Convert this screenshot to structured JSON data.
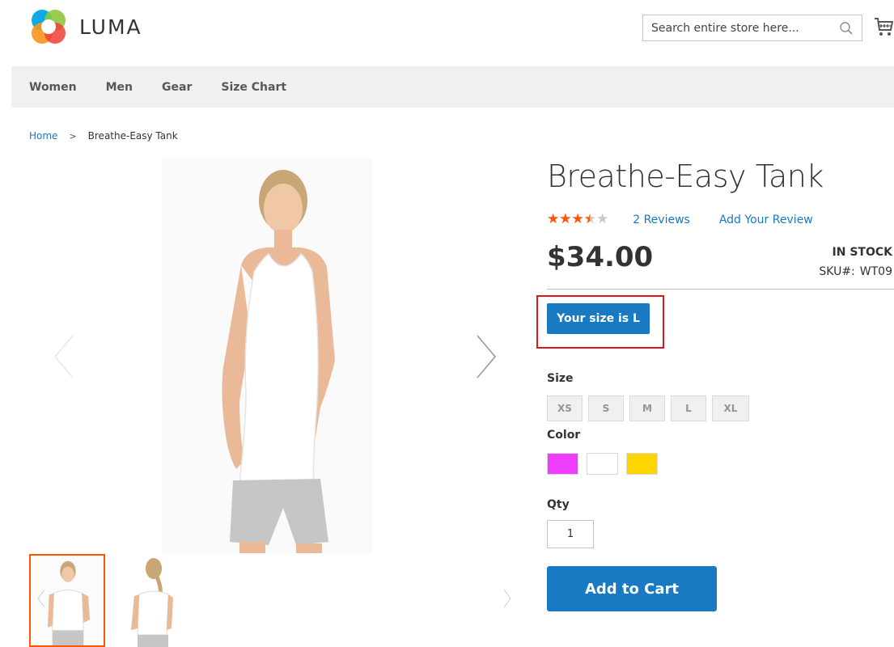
{
  "header": {
    "logo_text": "LUMA",
    "search_placeholder": "Search entire store here...",
    "icons": [
      "luma-logo-icon",
      "search-icon",
      "cart-icon"
    ]
  },
  "nav": {
    "items": [
      "Women",
      "Men",
      "Gear",
      "Size Chart"
    ]
  },
  "breadcrumb": {
    "home": "Home",
    "separator": ">",
    "current": "Breathe-Easy Tank"
  },
  "product": {
    "name": "Breathe-Easy Tank",
    "rating_percent": 70,
    "stars": "★★★★★",
    "reviews_count": "2",
    "reviews_label": "Reviews",
    "add_review": "Add Your Review",
    "price": "$34.00",
    "stock": "IN STOCK",
    "sku_label": "SKU#:",
    "sku": "WT09",
    "size_recommendation": "Your size is L",
    "size_label": "Size",
    "sizes": [
      "XS",
      "S",
      "M",
      "L",
      "XL"
    ],
    "color_label": "Color",
    "colors": [
      "#ef3dff",
      "#ffffff",
      "#ffd500"
    ],
    "qty_label": "Qty",
    "qty_value": "1",
    "add_to_cart": "Add to Cart"
  },
  "colors": {
    "accent": "#1979c3",
    "rating": "#ff5501",
    "highlight_box": "#e0141a",
    "nav_bg": "#f0f0f0"
  }
}
